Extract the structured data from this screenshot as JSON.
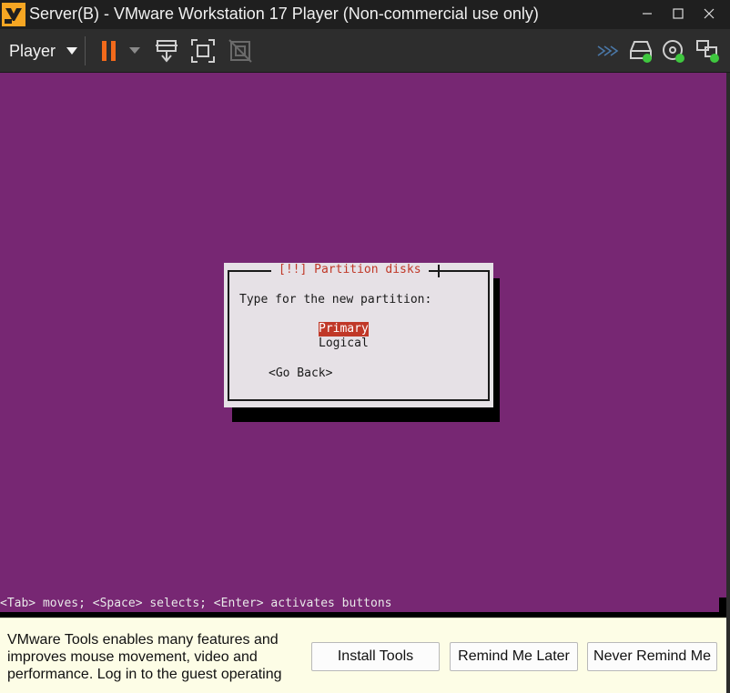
{
  "window": {
    "title": "Server(B) - VMware Workstation 17 Player (Non-commercial use only)"
  },
  "toolbar": {
    "player_label": "Player"
  },
  "colors": {
    "vm_background": "#772773",
    "pause_accent": "#f26a1b",
    "dialog_title": "#c03828",
    "selection": "#c03828",
    "device_active": "#3fc73f"
  },
  "installer": {
    "dialog_title": "[!!] Partition disks",
    "prompt": "Type for the new partition:",
    "options": [
      {
        "label": "Primary",
        "selected": true
      },
      {
        "label": "Logical",
        "selected": false
      }
    ],
    "go_back": "<Go Back>",
    "status_hint": "<Tab> moves; <Space> selects; <Enter> activates buttons"
  },
  "notification": {
    "message": "VMware Tools enables many features and improves mouse movement, video and performance. Log in to the guest operating",
    "install_button": "Install Tools",
    "remind_later_button": "Remind Me Later",
    "never_remind_button": "Never Remind Me"
  },
  "icons": [
    "vmware-logo-icon",
    "minimize-icon",
    "maximize-icon",
    "close-icon",
    "pause-icon",
    "dropdown-icon",
    "send-ctrl-alt-del-icon",
    "full-screen-icon",
    "unity-icon",
    "forward-arrows-icon",
    "hard-disk-icon",
    "cd-dvd-icon",
    "network-adapter-icon"
  ]
}
